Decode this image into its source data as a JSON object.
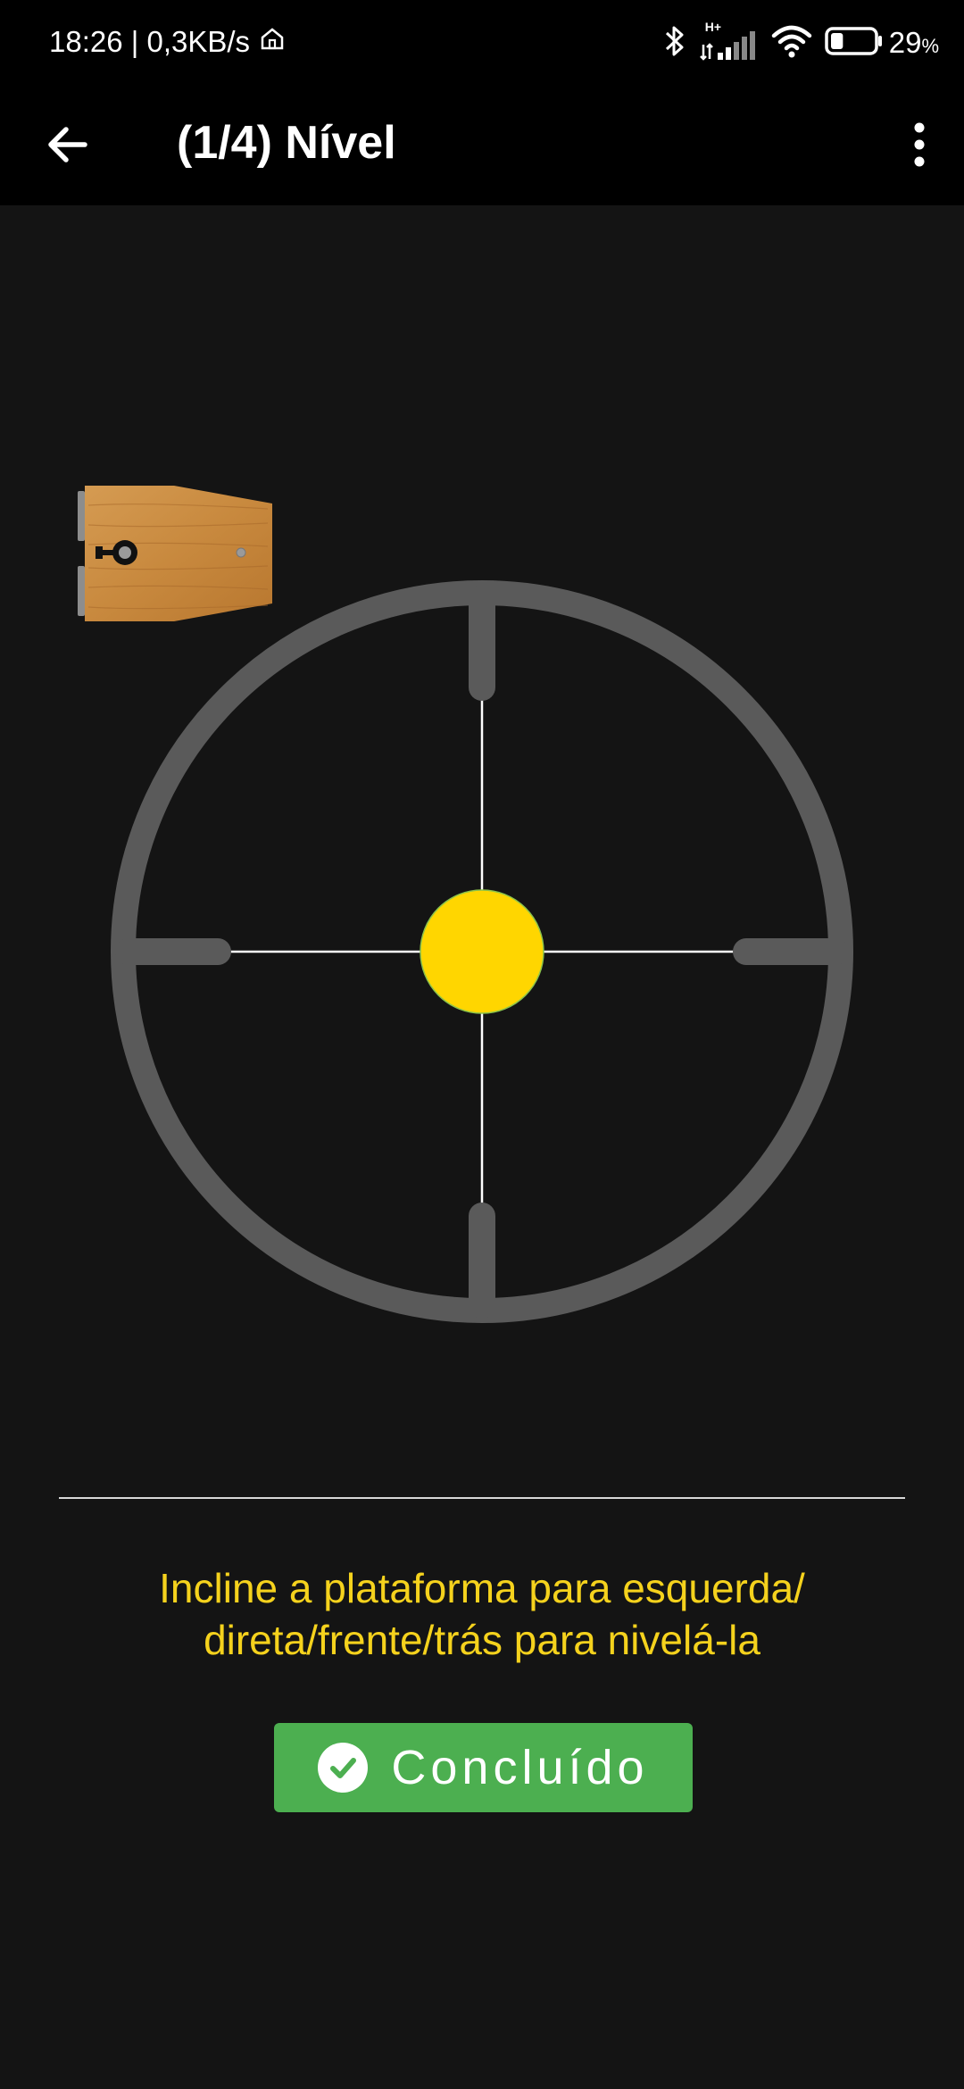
{
  "status_bar": {
    "time_speed": "18:26 | 0,3KB/s",
    "network_type": "H+",
    "battery_percent": "29",
    "battery_unit": "%",
    "battery_level": 0.29,
    "icons": [
      "home-icon",
      "bluetooth-icon",
      "signal-icon",
      "wifi-icon",
      "battery-icon"
    ]
  },
  "app_bar": {
    "title": "(1/4) Nível",
    "back_icon": "arrow-left-icon",
    "menu_icon": "more-vertical-icon"
  },
  "level": {
    "bubble_color": "#ffd600",
    "ring_color": "#5a5a5a",
    "crosshair_color": "#ffffff"
  },
  "instruction": {
    "line1": "Incline a plataforma para esquerda/",
    "line2": "direta/frente/trás para nivelá-la",
    "color": "#f5d21d"
  },
  "done_button": {
    "label": "Concluído",
    "icon": "check-circle-icon",
    "color": "#4caf50"
  }
}
